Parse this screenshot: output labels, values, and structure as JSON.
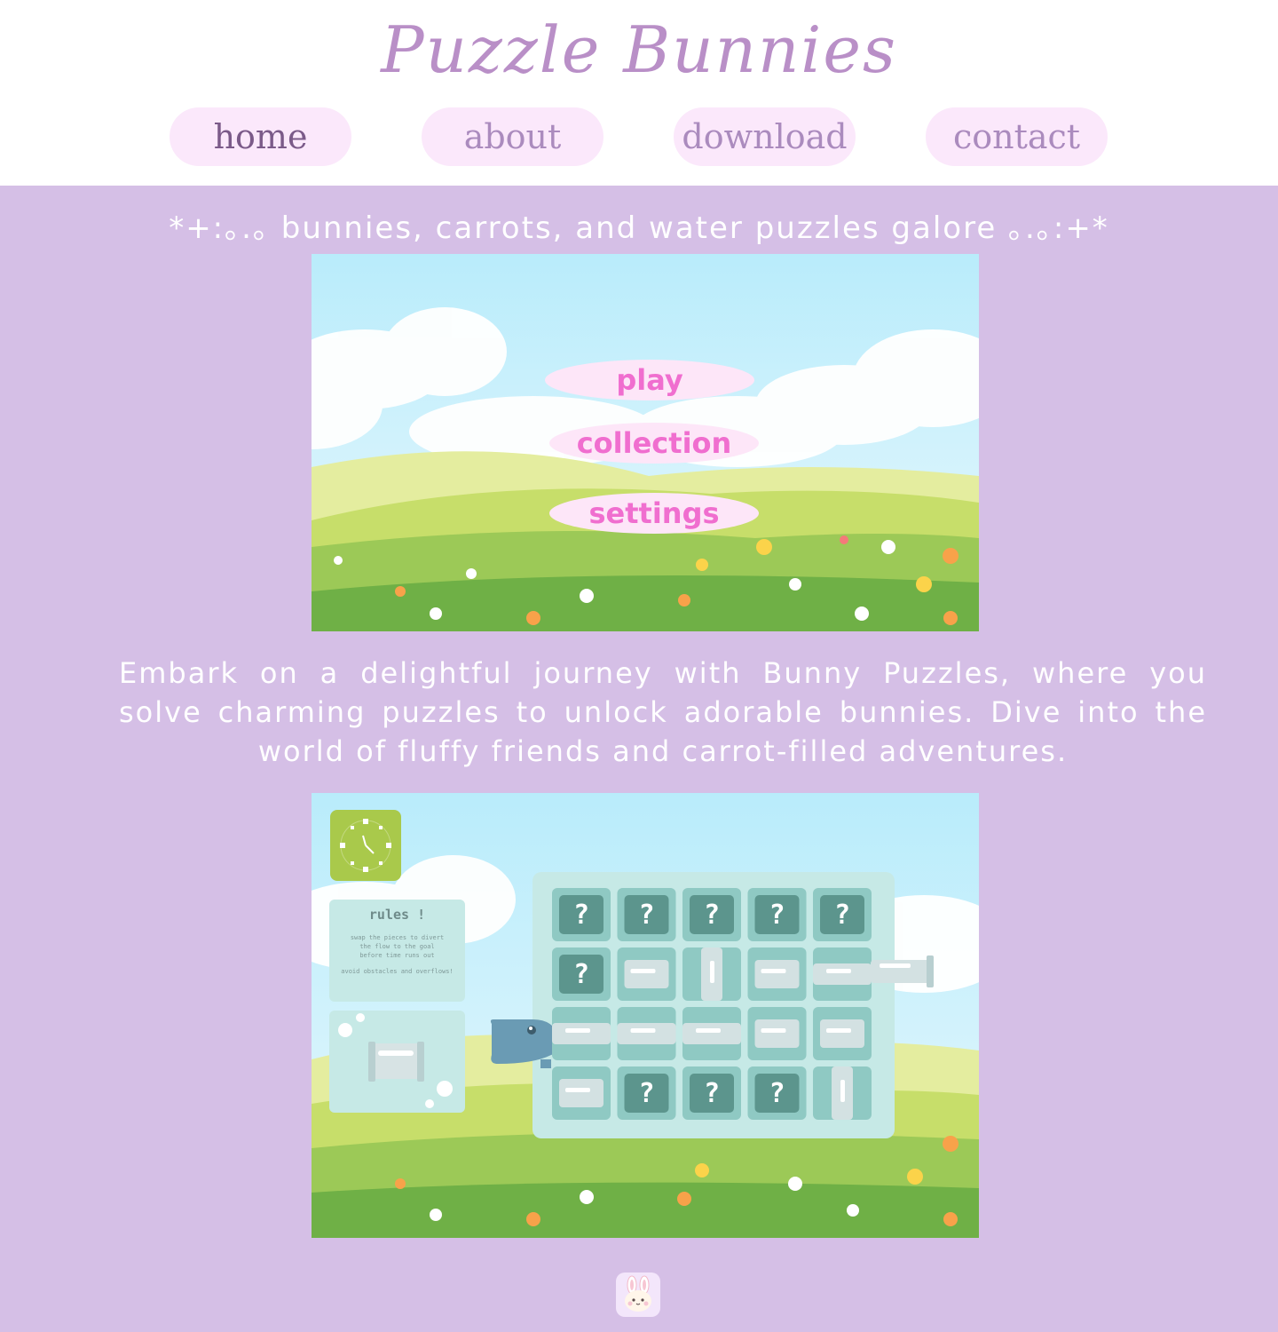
{
  "header": {
    "site_title": "Puzzle Bunnies",
    "nav": [
      {
        "label": "home",
        "active": true
      },
      {
        "label": "about",
        "active": false
      },
      {
        "label": "download",
        "active": false
      },
      {
        "label": "contact",
        "active": false
      }
    ]
  },
  "main": {
    "tagline": "*+:｡.｡ bunnies, carrots, and water puzzles galore ｡.｡:+*",
    "menu_screenshot": {
      "buttons": [
        "play",
        "collection",
        "settings"
      ]
    },
    "intro": "Embark on a delightful journey with Bunny Puzzles, where you solve charming puzzles to unlock adorable bunnies. Dive into the world of fluffy friends and carrot-filled adventures.",
    "game_screenshot": {
      "rules_title": "rules !",
      "rules_lines": [
        "swap the pieces to divert",
        "the flow to the goal",
        "before time runs out",
        "",
        "avoid obstacles and overflows!"
      ],
      "unknown_tile": "?"
    }
  },
  "colors": {
    "page_bg": "#d5bfe6",
    "header_bg": "#ffffff",
    "title": "#b98fc7",
    "nav_pill": "#fbe8fb",
    "menu_text": "#f06ecf"
  },
  "icons": {
    "footer": "bunny-app-icon",
    "timer": "clock-icon"
  }
}
